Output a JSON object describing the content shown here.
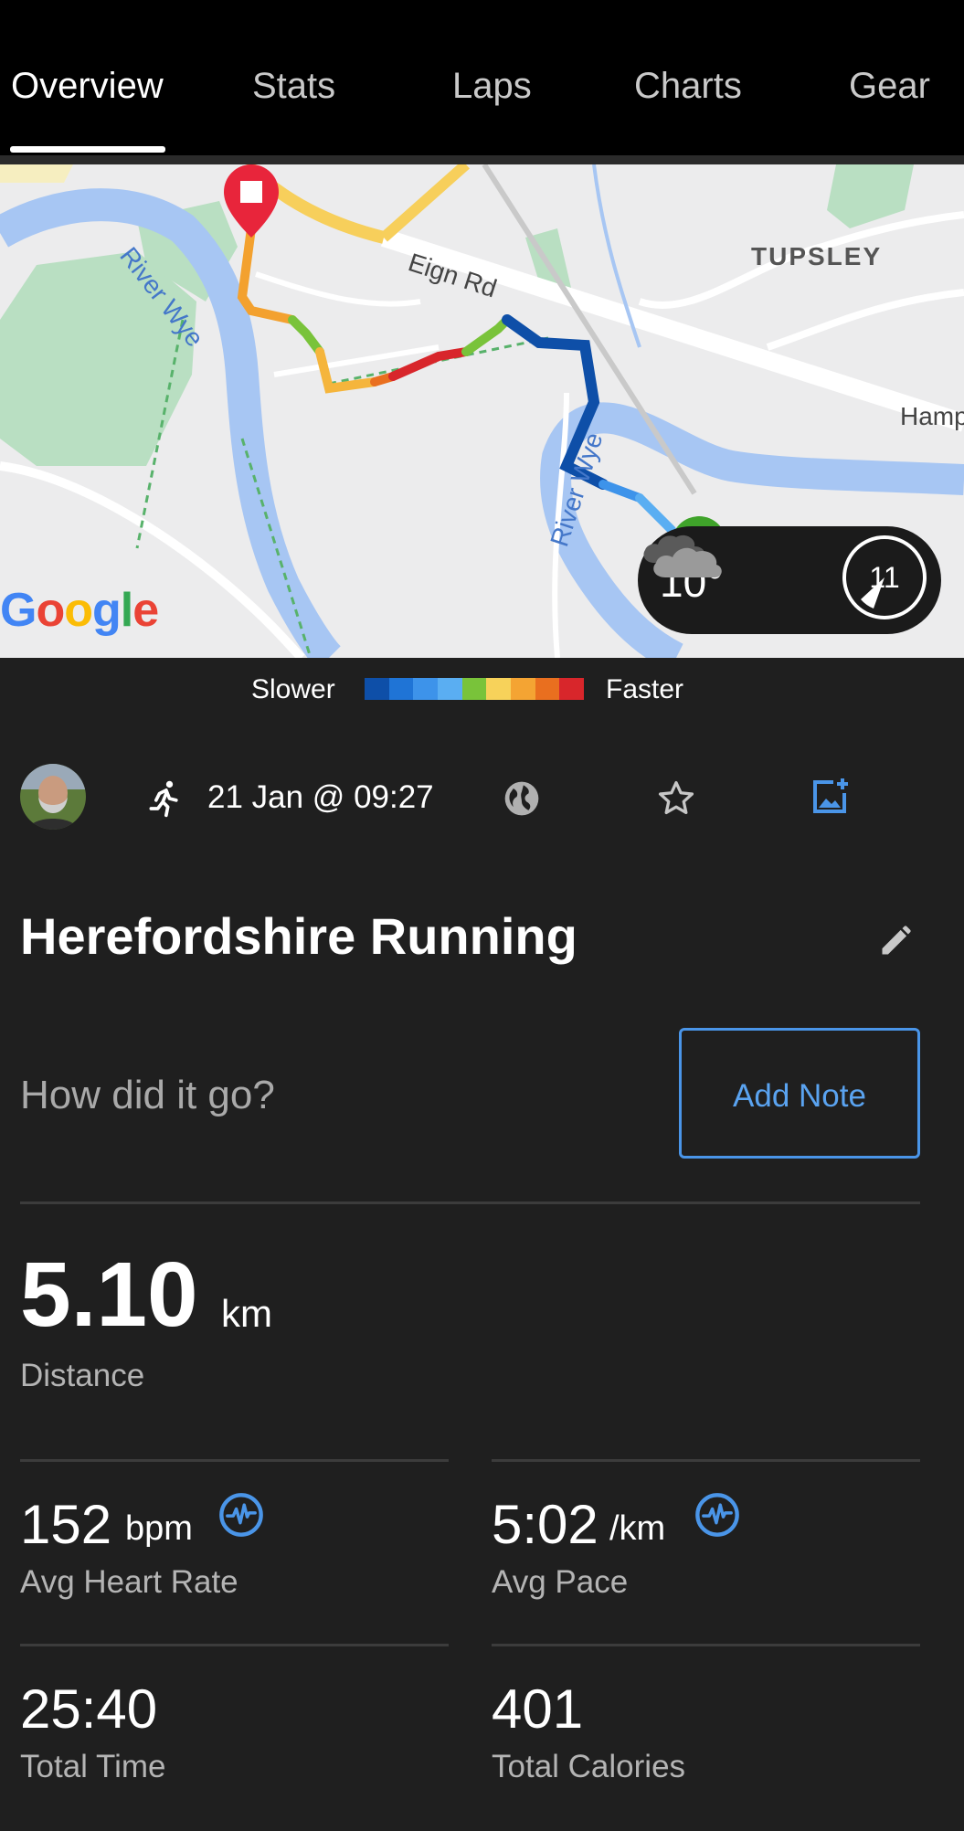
{
  "tabs": [
    {
      "label": "Overview",
      "active": true
    },
    {
      "label": "Stats",
      "active": false
    },
    {
      "label": "Laps",
      "active": false
    },
    {
      "label": "Charts",
      "active": false
    },
    {
      "label": "Gear",
      "active": false
    }
  ],
  "map": {
    "labels": {
      "river1": "River Wye",
      "river2": "River Wye",
      "road": "Eign Rd",
      "area": "TUPSLEY",
      "road2": "Hamp"
    },
    "logo": "Google",
    "weather": {
      "temperature": "10°",
      "icon": "cloud-icon",
      "indicator": "11"
    }
  },
  "legend": {
    "slower": "Slower",
    "faster": "Faster",
    "colors": [
      "#0e4fa8",
      "#1f74d6",
      "#3d93ea",
      "#5aaef2",
      "#79c33a",
      "#f7d25a",
      "#f4a433",
      "#e96f1f",
      "#d8262b"
    ]
  },
  "activity": {
    "type_icon": "running-icon",
    "date": "21 Jan @ 09:27",
    "title": "Herefordshire Running",
    "note_prompt": "How did it go?",
    "add_note_label": "Add Note"
  },
  "stats": {
    "distance": {
      "value": "5.10",
      "unit": "km",
      "label": "Distance"
    },
    "heart_rate": {
      "value": "152",
      "unit": "bpm",
      "label": "Avg Heart Rate"
    },
    "pace": {
      "value": "5:02",
      "unit": "/km",
      "label": "Avg Pace"
    },
    "time": {
      "value": "25:40",
      "label": "Total Time"
    },
    "calories": {
      "value": "401",
      "label": "Total Calories"
    }
  },
  "colors": {
    "accent": "#4a95e8",
    "background": "#1f1f1f",
    "topbar": "#000000"
  }
}
